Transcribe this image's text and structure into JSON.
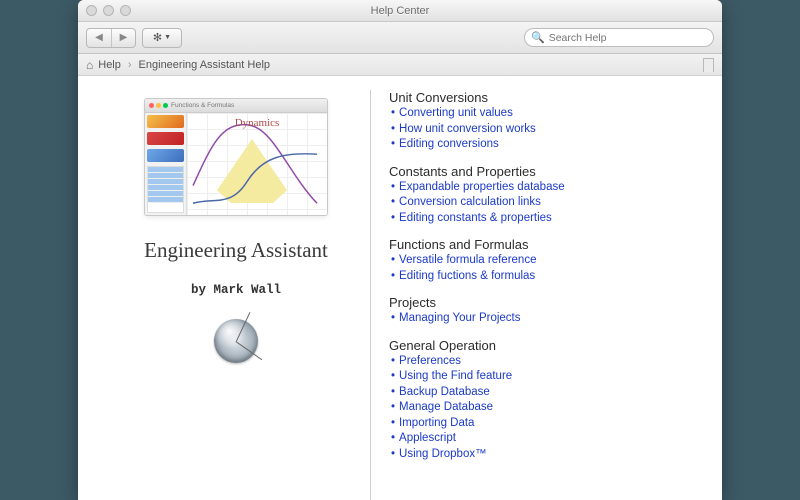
{
  "window": {
    "title": "Help Center"
  },
  "search": {
    "placeholder": "Search Help"
  },
  "breadcrumb": {
    "root": "Help",
    "page": "Engineering Assistant Help"
  },
  "hero": {
    "thumb_label": "Dynamics",
    "thumb_tab": "Functions & Formulas",
    "app_title": "Engineering Assistant",
    "app_author": "by Mark Wall"
  },
  "sections": [
    {
      "heading": "Unit Conversions",
      "links": [
        "Converting unit values",
        "How unit conversion works",
        "Editing conversions"
      ]
    },
    {
      "heading": "Constants and Properties",
      "links": [
        "Expandable properties database",
        "Conversion calculation links",
        "Editing constants & properties"
      ]
    },
    {
      "heading": "Functions and Formulas",
      "links": [
        "Versatile formula reference",
        "Editing fuctions & formulas"
      ]
    },
    {
      "heading": "Projects",
      "links": [
        "Managing Your Projects"
      ]
    },
    {
      "heading": "General Operation",
      "links": [
        "Preferences",
        "Using the Find feature",
        "Backup Database",
        "Manage Database",
        "Importing Data",
        "Applescript",
        "Using Dropbox™"
      ]
    }
  ]
}
